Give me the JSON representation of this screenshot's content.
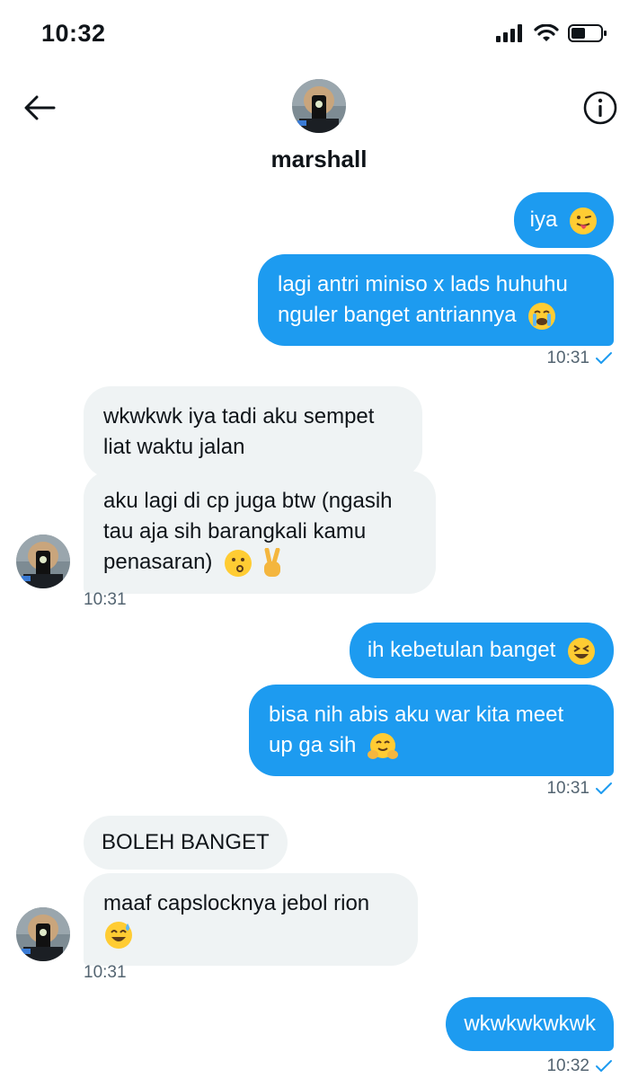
{
  "status": {
    "time": "10:32"
  },
  "header": {
    "name": "marshall"
  },
  "messages": [
    {
      "text": "iya",
      "emoji": "tongue-face"
    },
    {
      "line1": "lagi antri miniso x lads huhuhu",
      "line2": "nguler banget antriannya",
      "emoji": "crying-face"
    },
    {
      "time": "10:31"
    },
    {
      "line1": "wkwkwk iya tadi aku sempet",
      "line2": "liat waktu jalan"
    },
    {
      "line1": "aku lagi di cp juga btw (ngasih",
      "line2": "tau aja sih barangkali kamu",
      "line3": "penasaran)",
      "emoji1": "kissing-face",
      "emoji2": "victory-hand"
    },
    {
      "time": "10:31"
    },
    {
      "text": "ih kebetulan banget",
      "emoji": "laughing-face"
    },
    {
      "line1": "bisa nih abis aku war kita meet",
      "line2": "up ga sih",
      "emoji": "hugging-face"
    },
    {
      "time": "10:31"
    },
    {
      "text": "BOLEH BANGET"
    },
    {
      "line1": "maaf capslocknya jebol rion",
      "emoji": "sweat-smile-face"
    },
    {
      "time": "10:31"
    },
    {
      "text": "wkwkwkwkwk"
    },
    {
      "time": "10:32"
    }
  ],
  "colors": {
    "sent_bubble": "#1d9bf0",
    "received_bubble": "#eff3f4",
    "meta_text": "#536471"
  }
}
